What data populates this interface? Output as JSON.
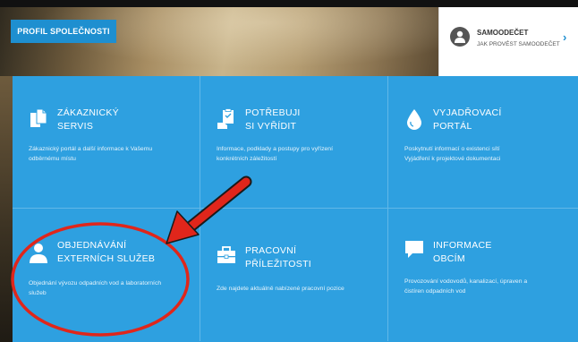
{
  "header": {
    "profile_button": "PROFIL SPOLEČNOSTI"
  },
  "self_reading": {
    "title": "SAMOODEČET",
    "subtitle": "JAK PROVÉST SAMOODEČET",
    "icon": "user-pin-icon",
    "chevron": "›"
  },
  "tiles": [
    {
      "title_line1": "ZÁKAZNICKÝ",
      "title_line2": "SERVIS",
      "description_line1": "Zákaznický portál a další informace k Vašemu",
      "description_line2": "odběrnému místu",
      "icon": "documents-icon"
    },
    {
      "title_line1": "POTŘEBUJI",
      "title_line2": "SI VYŘÍDIT",
      "description_line1": "Informace, podklady a postupy pro vyřízení",
      "description_line2": "konkrétních záležitostí",
      "icon": "clipboard-hand-icon"
    },
    {
      "title_line1": "VYJADŘOVACÍ",
      "title_line2": "PORTÁL",
      "description_line1": "Poskytnutí informací o existenci sítí",
      "description_line2": "Vyjádření k projektové dokumentaci",
      "icon": "water-drop-icon"
    },
    {
      "title_line1": "OBJEDNÁVÁNÍ",
      "title_line2": "EXTERNÍCH SLUŽEB",
      "description_line1": "Objednání vývozu odpadních vod a laboratorních",
      "description_line2": "služeb",
      "icon": "person-icon"
    },
    {
      "title_line1": "PRACOVNÍ",
      "title_line2": "PŘÍLEŽITOSTI",
      "description_line1": "Zde najdete aktuálně nabízené pracovní pozice",
      "description_line2": "",
      "icon": "briefcase-icon"
    },
    {
      "title_line1": "INFORMACE",
      "title_line2": "OBCÍM",
      "description_line1": "Provozování vodovodů, kanalizací, úpraven a",
      "description_line2": "čistíren odpadních vod",
      "icon": "speech-bubble-icon"
    }
  ],
  "colors": {
    "tile_blue": "#2ea0e0",
    "button_blue": "#1e8fd0",
    "annotation_red": "#e0261b"
  }
}
